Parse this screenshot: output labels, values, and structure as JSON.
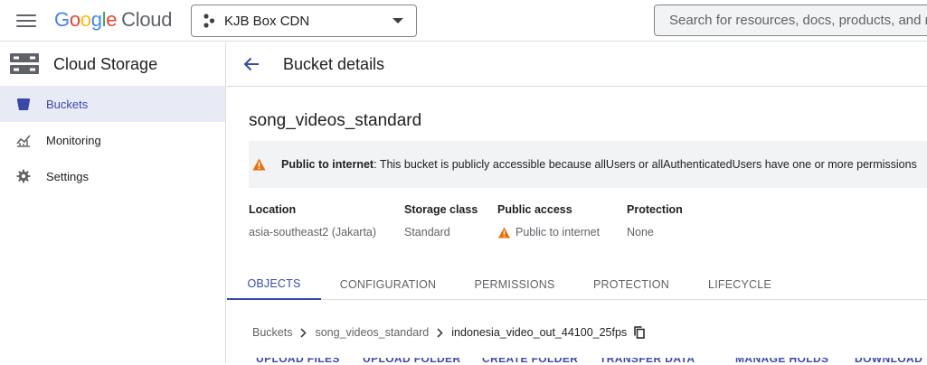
{
  "header": {
    "logo": {
      "g1": "G",
      "g2": "o",
      "g3": "o",
      "g4": "g",
      "g5": "l",
      "g6": "e",
      "suffix": "Cloud"
    },
    "project_name": "KJB Box CDN",
    "search_placeholder": "Search for resources, docs, products, and more"
  },
  "sidebar": {
    "title": "Cloud Storage",
    "items": [
      {
        "label": "Buckets",
        "icon": "bucket-icon",
        "active": true
      },
      {
        "label": "Monitoring",
        "icon": "chart-icon",
        "active": false
      },
      {
        "label": "Settings",
        "icon": "gear-icon",
        "active": false
      }
    ]
  },
  "page": {
    "title": "Bucket details",
    "bucket_name": "song_videos_standard",
    "banner": {
      "bold": "Public to internet",
      "text": ": This bucket is publicly accessible because allUsers or allAuthenticatedUsers have one or more permissions"
    },
    "properties": [
      {
        "key": "Location",
        "value": "asia-southeast2 (Jakarta)"
      },
      {
        "key": "Storage class",
        "value": "Standard"
      },
      {
        "key": "Public access",
        "value": "Public to internet"
      },
      {
        "key": "Protection",
        "value": "None"
      }
    ],
    "tabs": [
      "OBJECTS",
      "CONFIGURATION",
      "PERMISSIONS",
      "PROTECTION",
      "LIFECYCLE"
    ],
    "breadcrumb": [
      "Buckets",
      "song_videos_standard",
      "indonesia_video_out_44100_25fps"
    ],
    "actions": [
      "UPLOAD FILES",
      "UPLOAD FOLDER",
      "CREATE FOLDER",
      "TRANSFER DATA",
      "MANAGE HOLDS",
      "DOWNLOAD"
    ]
  },
  "colors": {
    "accent": "#3949ab",
    "warning": "#e8710a",
    "active_bg": "#e8eaf6"
  }
}
